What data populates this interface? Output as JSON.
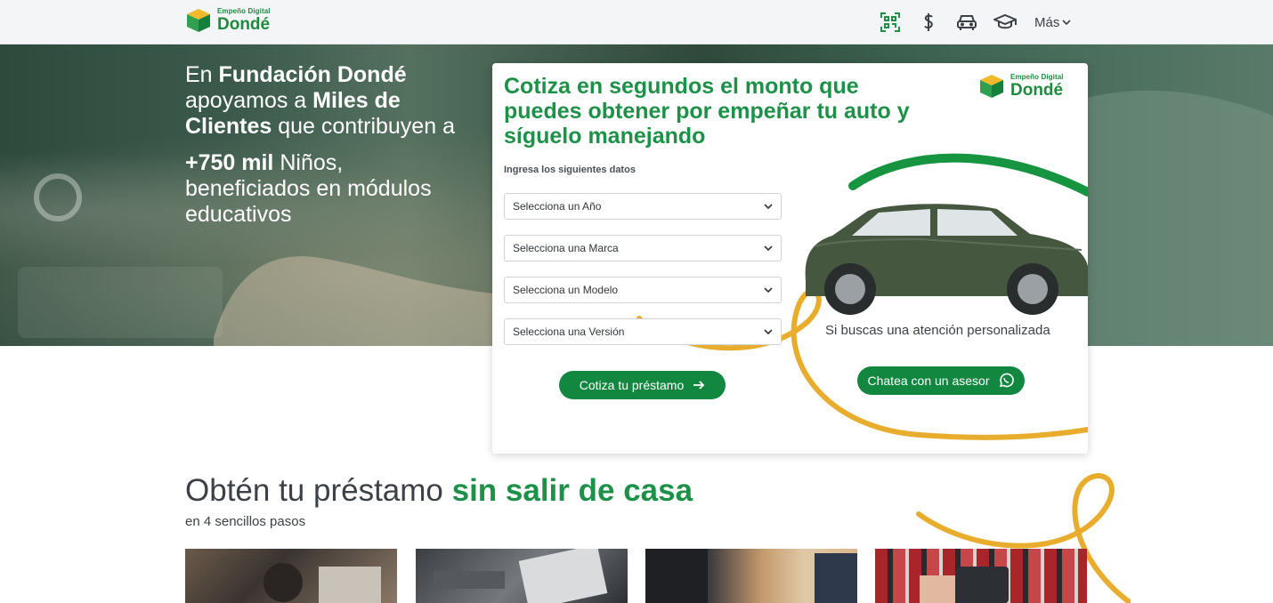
{
  "header": {
    "logo": {
      "small": "Empeño Digital",
      "big": "Dondé"
    },
    "nav": [
      {
        "icon": "qr-code-icon"
      },
      {
        "icon": "dollar-icon"
      },
      {
        "icon": "car-icon"
      },
      {
        "icon": "graduation-cap-icon"
      }
    ],
    "more_label": "Más"
  },
  "hero": {
    "line1_pre": "En ",
    "line1_bold": "Fundación Dondé",
    "line2_pre": "apoyamos a ",
    "line2_bold": "Miles de",
    "line3_bold": "Clientes",
    "line3_post": " que contribuyen a",
    "line4_bold": "+750 mil",
    "line4_post": " Niños,",
    "line5": "beneficiados en módulos",
    "line6": "educativos"
  },
  "form": {
    "title": "Cotiza en segundos el monto que puedes obtener por empeñar tu auto y síguelo manejando",
    "logo": {
      "small": "Empeño Digital",
      "big": "Dondé"
    },
    "subtitle": "Ingresa los siguientes datos",
    "selects": [
      {
        "label": "Selecciona un Año"
      },
      {
        "label": "Selecciona una Marca"
      },
      {
        "label": "Selecciona un Modelo"
      },
      {
        "label": "Selecciona una Versión"
      }
    ],
    "quote_button": "Cotiza tu préstamo",
    "personal_text": "Si buscas una atención personalizada",
    "chat_button": "Chatea con un asesor"
  },
  "section": {
    "title_pre": "Obtén tu préstamo ",
    "title_highlight": "sin salir de casa",
    "subtitle": "en 4 sencillos pasos"
  },
  "colors": {
    "brand_green": "#1e9148",
    "button_green": "#12873f",
    "accent_yellow": "#e9ad2e"
  }
}
